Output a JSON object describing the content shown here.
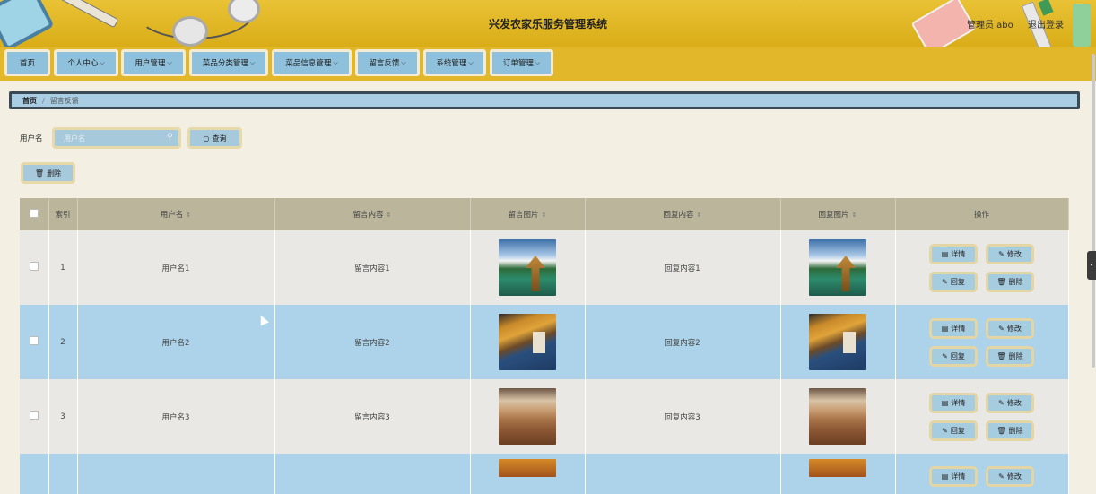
{
  "header": {
    "title": "兴发农家乐服务管理系统",
    "user": "管理员 abo",
    "logout": "退出登录"
  },
  "nav": [
    {
      "label": "首页",
      "has_dropdown": false
    },
    {
      "label": "个人中心",
      "has_dropdown": true
    },
    {
      "label": "用户管理",
      "has_dropdown": true
    },
    {
      "label": "菜品分类管理",
      "has_dropdown": true
    },
    {
      "label": "菜品信息管理",
      "has_dropdown": true
    },
    {
      "label": "留言反馈",
      "has_dropdown": true
    },
    {
      "label": "系统管理",
      "has_dropdown": true
    },
    {
      "label": "订单管理",
      "has_dropdown": true
    }
  ],
  "breadcrumb": {
    "home": "首页",
    "separator": "/",
    "current": "留言反馈"
  },
  "search": {
    "label": "用户名",
    "placeholder": "用户名",
    "button": "查询"
  },
  "actions": {
    "delete": "删除"
  },
  "table": {
    "columns": [
      "索引",
      "用户名",
      "留言内容",
      "留言图片",
      "回复内容",
      "回复图片",
      "操作"
    ],
    "rows": [
      {
        "index": "1",
        "username": "用户名1",
        "message": "留言内容1",
        "message_image": "lake",
        "reply": "回复内容1",
        "reply_image": "lake"
      },
      {
        "index": "2",
        "username": "用户名2",
        "message": "留言内容2",
        "message_image": "road",
        "reply": "回复内容2",
        "reply_image": "road"
      },
      {
        "index": "3",
        "username": "用户名3",
        "message": "留言内容3",
        "message_image": "desert",
        "reply": "回复内容3",
        "reply_image": "desert"
      },
      {
        "index": "",
        "username": "",
        "message": "",
        "message_image": "autumn",
        "reply": "",
        "reply_image": "autumn"
      }
    ],
    "row_actions": {
      "detail": "详情",
      "edit": "修改",
      "reply": "回复",
      "delete": "删除"
    }
  },
  "colors": {
    "header_bg": "#e3b72a",
    "button_bg": "#a7c9dc",
    "table_header_bg": "#bab59b",
    "row_highlight_bg": "#acd3e9"
  }
}
